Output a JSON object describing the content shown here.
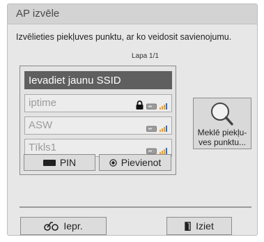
{
  "window": {
    "title": "AP izvēle"
  },
  "instruction": "Izvēlieties piekļuves punktu, ar ko veidosit savienojumu.",
  "page_indicator": "Lapa 1/1",
  "networks": [
    {
      "label": "Ievadiet jaunu SSID",
      "selected": true
    },
    {
      "label": "iptime",
      "locked": true,
      "icons": [
        "lock-icon",
        "router-icon",
        "signal-icon"
      ]
    },
    {
      "label": "ASW",
      "locked": false,
      "icons": [
        "router-icon",
        "signal-icon"
      ]
    },
    {
      "label": "Tīkls1",
      "locked": false,
      "icons": [
        "router-icon",
        "signal-icon"
      ]
    }
  ],
  "buttons": {
    "pin": "PIN",
    "connect": "Pievienot",
    "search_line1": "Meklē piekļu-",
    "search_line2": "ves punktu...",
    "back": "Iepr.",
    "exit": "Iziet"
  },
  "colors": {
    "selected_bg": "#5f5f5f",
    "signal_bars": "#f0a020",
    "dialog_bg": "#e7e7e7"
  }
}
